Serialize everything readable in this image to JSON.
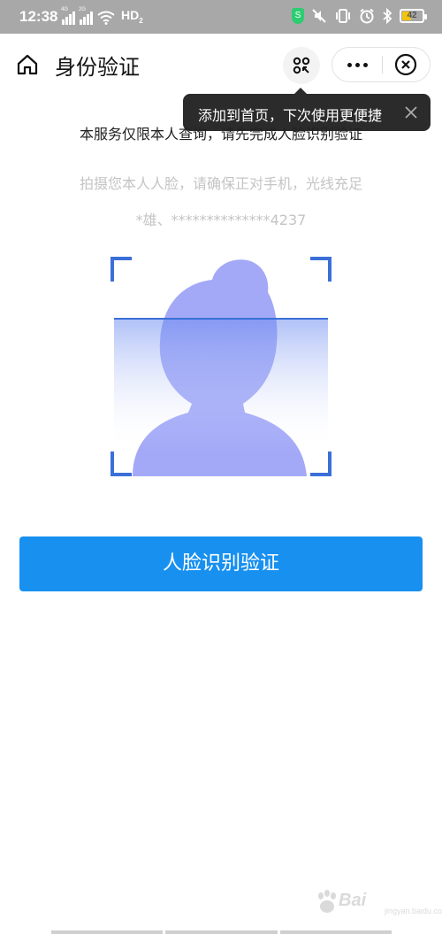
{
  "status_bar": {
    "time": "12:38",
    "network": "HD",
    "network_sub": "2",
    "battery": "42",
    "sig1_label": "4G",
    "sig2_label": "2G"
  },
  "nav": {
    "title": "身份验证"
  },
  "tooltip": {
    "text": "添加到首页，下次使用更便捷"
  },
  "content": {
    "notice": "本服务仅限本人查询，请先完成人脸识别验证",
    "hint": "拍摄您本人人脸，请确保正对手机，光线充足",
    "user_id": "*雄、**************4237"
  },
  "button": {
    "label": "人脸识别验证"
  },
  "watermark": {
    "text": "Bai",
    "sub": "jingyan.baidu.com",
    "icon_name": "baidu-paw-icon"
  },
  "colors": {
    "primary": "#1890f0",
    "frame": "#3a6fd8",
    "avatar": "#a3a9f7"
  }
}
